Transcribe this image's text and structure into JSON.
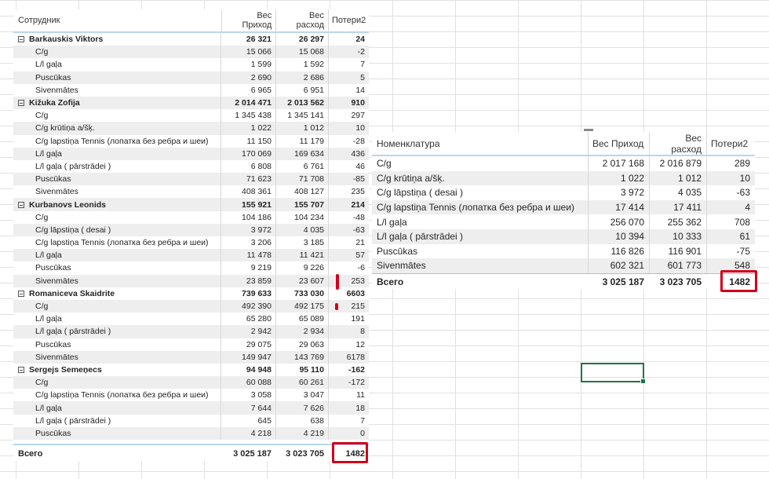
{
  "matrix": {
    "headers": {
      "col1": "Сотрудник",
      "col2": "Вес Приход",
      "col3": "Вес расход",
      "col4": "Потери2"
    },
    "rows": [
      {
        "type": "group",
        "name": "Barkauskis Viktors",
        "in": "26 321",
        "out": "26 297",
        "loss": "24"
      },
      {
        "type": "sub",
        "name": "C/g",
        "in": "15 066",
        "out": "15 068",
        "loss": "-2"
      },
      {
        "type": "sub",
        "name": "L/l gaļa",
        "in": "1 599",
        "out": "1 592",
        "loss": "7"
      },
      {
        "type": "sub",
        "name": "Puscūkas",
        "in": "2 690",
        "out": "2 686",
        "loss": "5"
      },
      {
        "type": "sub",
        "name": "Sivenmātes",
        "in": "6 965",
        "out": "6 951",
        "loss": "14"
      },
      {
        "type": "group",
        "name": "Kižuka Zofija",
        "in": "2 014 471",
        "out": "2 013 562",
        "loss": "910"
      },
      {
        "type": "sub",
        "name": "C/g",
        "in": "1 345 438",
        "out": "1 345 141",
        "loss": "297"
      },
      {
        "type": "sub",
        "name": "C/g krūtiņa a/šķ.",
        "in": "1 022",
        "out": "1 012",
        "loss": "10"
      },
      {
        "type": "sub",
        "name": "C/g lapstiņa Tennis (лопатка без ребра и шеи)",
        "in": "11 150",
        "out": "11 179",
        "loss": "-28"
      },
      {
        "type": "sub",
        "name": "L/l gaļa",
        "in": "170 069",
        "out": "169 634",
        "loss": "436"
      },
      {
        "type": "sub",
        "name": "L/l gaļa ( pārstrādei )",
        "in": "6 808",
        "out": "6 761",
        "loss": "46"
      },
      {
        "type": "sub",
        "name": "Puscūkas",
        "in": "71 623",
        "out": "71 708",
        "loss": "-85"
      },
      {
        "type": "sub",
        "name": "Sivenmātes",
        "in": "408 361",
        "out": "408 127",
        "loss": "235"
      },
      {
        "type": "group",
        "name": "Kurbanovs Leonids",
        "in": "155 921",
        "out": "155 707",
        "loss": "214"
      },
      {
        "type": "sub",
        "name": "C/g",
        "in": "104 186",
        "out": "104 234",
        "loss": "-48"
      },
      {
        "type": "sub",
        "name": "C/g lāpstiņa ( desai )",
        "in": "3 972",
        "out": "4 035",
        "loss": "-63"
      },
      {
        "type": "sub",
        "name": "C/g lapstiņa Tennis (лопатка без ребра и шеи)",
        "in": "3 206",
        "out": "3 185",
        "loss": "21"
      },
      {
        "type": "sub",
        "name": "L/l gaļa",
        "in": "11 478",
        "out": "11 421",
        "loss": "57"
      },
      {
        "type": "sub",
        "name": "Puscūkas",
        "in": "9 219",
        "out": "9 226",
        "loss": "-6"
      },
      {
        "type": "sub",
        "name": "Sivenmātes",
        "in": "23 859",
        "out": "23 607",
        "loss": "253"
      },
      {
        "type": "group",
        "name": "Romaniceva Skaidrite",
        "in": "739 633",
        "out": "733 030",
        "loss": "6603"
      },
      {
        "type": "sub",
        "name": "C/g",
        "in": "492 390",
        "out": "492 175",
        "loss": "215"
      },
      {
        "type": "sub",
        "name": "L/l gaļa",
        "in": "65 280",
        "out": "65 089",
        "loss": "191"
      },
      {
        "type": "sub",
        "name": "L/l gaļa ( pārstrādei )",
        "in": "2 942",
        "out": "2 934",
        "loss": "8"
      },
      {
        "type": "sub",
        "name": "Puscūkas",
        "in": "29 075",
        "out": "29 063",
        "loss": "12"
      },
      {
        "type": "sub",
        "name": "Sivenmātes",
        "in": "149 947",
        "out": "143 769",
        "loss": "6178"
      },
      {
        "type": "group",
        "name": "Sergejs Semeņecs",
        "in": "94 948",
        "out": "95 110",
        "loss": "-162"
      },
      {
        "type": "sub",
        "name": "C/g",
        "in": "60 088",
        "out": "60 261",
        "loss": "-172"
      },
      {
        "type": "sub",
        "name": "C/g lapstiņa Tennis (лопатка без ребра и шеи)",
        "in": "3 058",
        "out": "3 047",
        "loss": "11"
      },
      {
        "type": "sub",
        "name": "L/l gaļa",
        "in": "7 644",
        "out": "7 626",
        "loss": "18"
      },
      {
        "type": "sub",
        "name": "L/l gaļa ( pārstrādei )",
        "in": "645",
        "out": "638",
        "loss": "7"
      },
      {
        "type": "sub",
        "name": "Puscūkas",
        "in": "4 218",
        "out": "4 219",
        "loss": "0"
      }
    ],
    "total": {
      "label": "Всего",
      "in": "3 025 187",
      "out": "3 023 705",
      "loss": "1482"
    }
  },
  "table": {
    "headers": {
      "col1": "Номенклатура",
      "col2": "Вес Приход",
      "col3": "Вес расход",
      "col4": "Потери2"
    },
    "rows": [
      {
        "name": "C/g",
        "in": "2 017 168",
        "out": "2 016 879",
        "loss": "289"
      },
      {
        "name": "C/g krūtiņa a/šķ.",
        "in": "1 022",
        "out": "1 012",
        "loss": "10"
      },
      {
        "name": "C/g lāpstiņa ( desai )",
        "in": "3 972",
        "out": "4 035",
        "loss": "-63"
      },
      {
        "name": "C/g lapstiņa Tennis (лопатка без ребра и шеи)",
        "in": "17 414",
        "out": "17 411",
        "loss": "4"
      },
      {
        "name": "L/l gaļa",
        "in": "256 070",
        "out": "255 362",
        "loss": "708"
      },
      {
        "name": "L/l gaļa ( pārstrādei )",
        "in": "10 394",
        "out": "10 333",
        "loss": "61"
      },
      {
        "name": "Puscūkas",
        "in": "116 826",
        "out": "116 901",
        "loss": "-75"
      },
      {
        "name": "Sivenmātes",
        "in": "602 321",
        "out": "601 773",
        "loss": "548"
      }
    ],
    "total": {
      "label": "Всего",
      "in": "3 025 187",
      "out": "3 023 705",
      "loss": "1482"
    }
  },
  "highlight_color": "#d0021b",
  "selection_color": "#217346"
}
